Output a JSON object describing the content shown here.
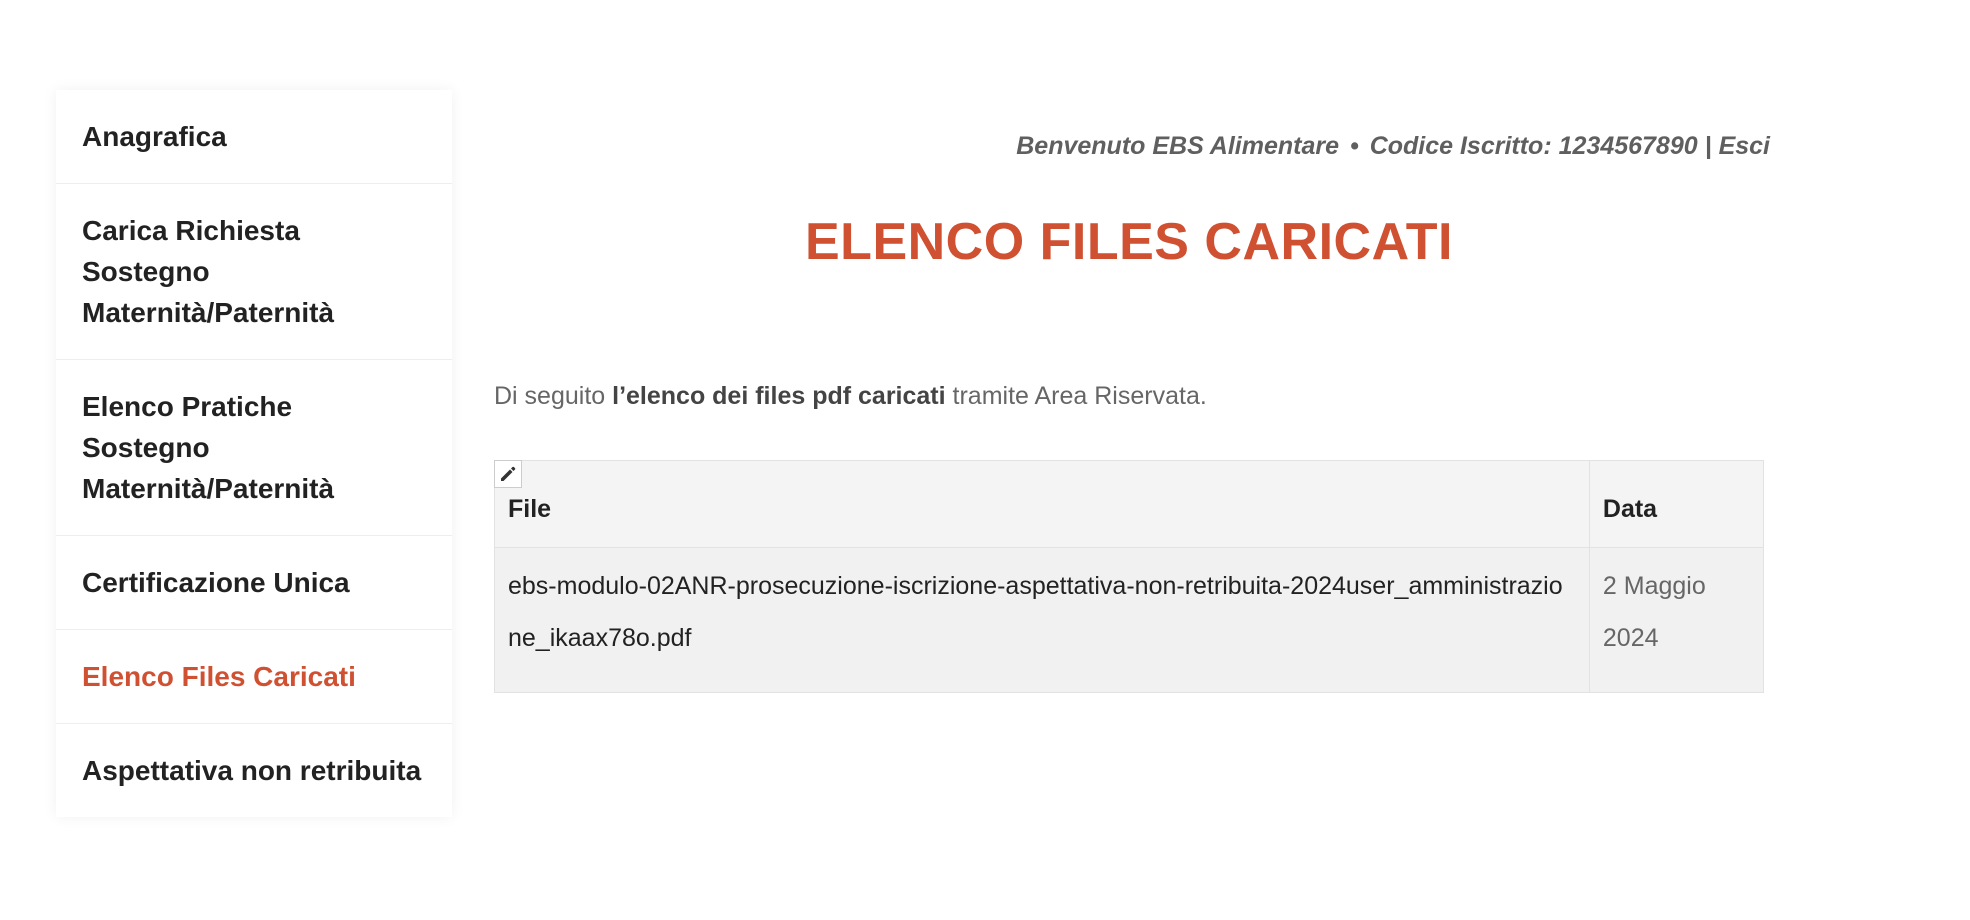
{
  "sidebar": {
    "items": [
      {
        "label": "Anagrafica"
      },
      {
        "label": "Carica Richiesta Sostegno Maternità/Paternità"
      },
      {
        "label": "Elenco Pratiche Sostegno Maternità/Paternità"
      },
      {
        "label": "Certificazione Unica"
      },
      {
        "label": "Elenco Files Caricati",
        "active": true
      },
      {
        "label": "Aspettativa non retribuita"
      }
    ]
  },
  "header": {
    "welcome_text": "Benvenuto EBS Alimentare",
    "separator": "•",
    "code_text": "Codice Iscritto: 1234567890",
    "divider": "|",
    "logout_label": "Esci"
  },
  "main": {
    "title": "ELENCO FILES CARICATI",
    "intro_prefix": "Di seguito",
    "intro_bold": "l’elenco dei files pdf caricati",
    "intro_suffix": "tramite Area Riservata."
  },
  "table": {
    "headers": {
      "file": "File",
      "date": "Data"
    },
    "rows": [
      {
        "file": "ebs-modulo-02ANR-prosecuzione-iscrizione-aspettativa-non-retribuita-2024user_amministrazione_ikaax78o.pdf",
        "date": "2 Maggio 2024"
      }
    ]
  },
  "colors": {
    "accent": "#cf5132",
    "text_dark": "#222222",
    "text_muted": "#666666"
  },
  "icons": {
    "edit": "pencil-icon"
  }
}
